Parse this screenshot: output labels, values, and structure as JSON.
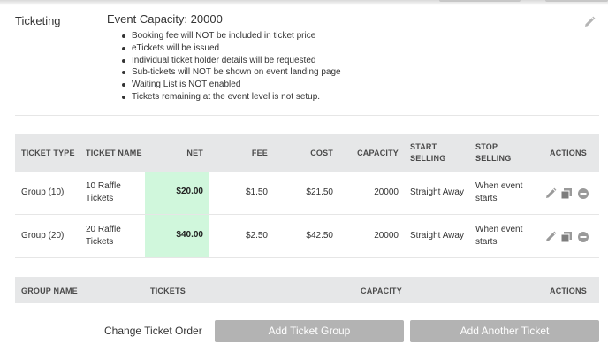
{
  "section": {
    "label": "Ticketing"
  },
  "event": {
    "capacity_title": "Event Capacity: 20000",
    "notes": [
      "Booking fee will NOT be included in ticket price",
      "eTickets will be issued",
      "Individual ticket holder details will be requested",
      "Sub-tickets will NOT be shown on event landing page",
      "Waiting List is NOT enabled",
      "Tickets remaining at the event level is not setup."
    ]
  },
  "tickets_table": {
    "headers": {
      "type": "TICKET TYPE",
      "name": "TICKET NAME",
      "net": "NET",
      "fee": "FEE",
      "cost": "COST",
      "capacity": "CAPACITY",
      "start_1": "START",
      "start_2": "SELLING",
      "stop_1": "STOP",
      "stop_2": "SELLING",
      "actions": "ACTIONS"
    },
    "rows": [
      {
        "type": "Group (10)",
        "name_1": "10 Raffle",
        "name_2": "Tickets",
        "net": "$20.00",
        "fee": "$1.50",
        "cost": "$21.50",
        "capacity": "20000",
        "start": "Straight Away",
        "stop_1": "When event",
        "stop_2": "starts"
      },
      {
        "type": "Group (20)",
        "name_1": "20 Raffle",
        "name_2": "Tickets",
        "net": "$40.00",
        "fee": "$2.50",
        "cost": "$42.50",
        "capacity": "20000",
        "start": "Straight Away",
        "stop_1": "When event",
        "stop_2": "starts"
      }
    ]
  },
  "groups_table": {
    "headers": {
      "group_name": "GROUP NAME",
      "tickets": "TICKETS",
      "capacity": "CAPACITY",
      "actions": "ACTIONS"
    }
  },
  "footer": {
    "change_order": "Change Ticket Order",
    "add_group": "Add Ticket Group",
    "add_ticket": "Add Another Ticket"
  },
  "colors": {
    "net_highlight": "#d0f7dc",
    "header_bg": "#e6e7e8",
    "button_bg": "#b3b3b3"
  },
  "icons": [
    "pencil-icon",
    "copy-icon",
    "remove-icon"
  ]
}
